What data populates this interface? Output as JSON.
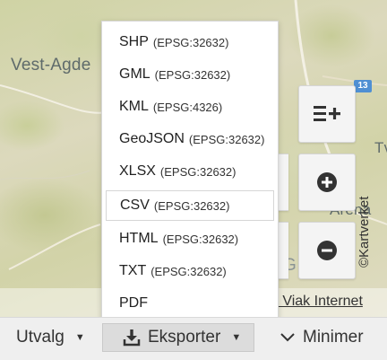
{
  "map": {
    "labels": {
      "vest_agder": "Vest-Agde",
      "tv": "Tve",
      "aren": "Arena",
      "g": "G"
    },
    "road_shield": "13",
    "attribution": "n Viak Internet",
    "kartverket": "©Kartverket"
  },
  "controls": {
    "legend_icon": "list-add-icon",
    "zoom_in_icon": "plus-circle-icon",
    "zoom_out_icon": "minus-circle-icon"
  },
  "export_menu": {
    "items": [
      {
        "format": "SHP",
        "crs": "(EPSG:32632)"
      },
      {
        "format": "GML",
        "crs": "(EPSG:32632)"
      },
      {
        "format": "KML",
        "crs": "(EPSG:4326)"
      },
      {
        "format": "GeoJSON",
        "crs": "(EPSG:32632)"
      },
      {
        "format": "XLSX",
        "crs": "(EPSG:32632)"
      },
      {
        "format": "CSV",
        "crs": "(EPSG:32632)"
      },
      {
        "format": "HTML",
        "crs": "(EPSG:32632)"
      },
      {
        "format": "TXT",
        "crs": "(EPSG:32632)"
      },
      {
        "format": "PDF",
        "crs": ""
      }
    ],
    "highlighted": "CSV"
  },
  "bottom_bar": {
    "utvalg_label": "Utvalg",
    "eksporter_label": "Eksporter",
    "minimer_label": "Minimer",
    "export_icon": "download-icon",
    "minimize_icon": "chevron-down-icon"
  },
  "colors": {
    "road_shield": "#4f8fd3",
    "icon_dark": "#333333"
  }
}
